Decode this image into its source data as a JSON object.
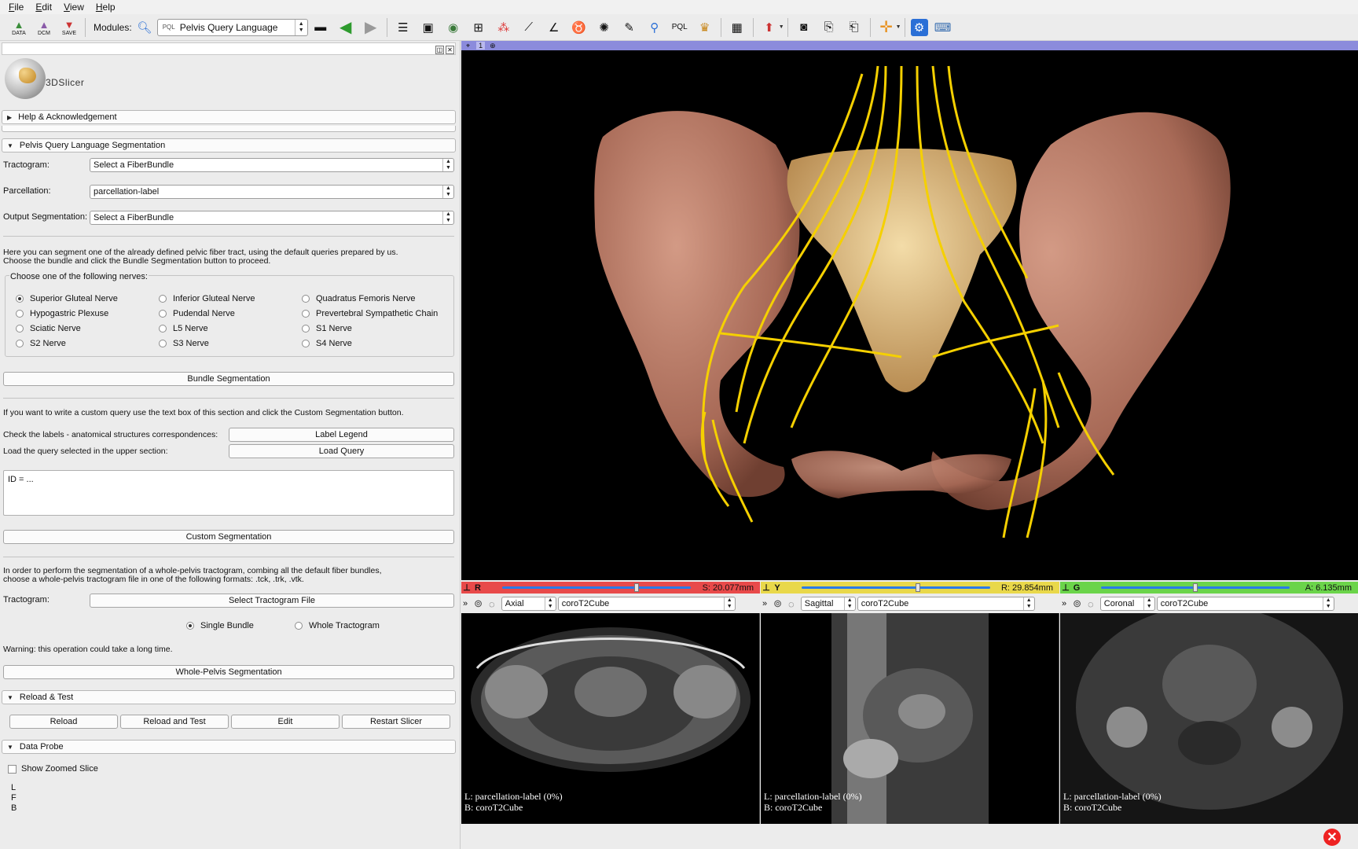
{
  "menu": [
    "File",
    "Edit",
    "View",
    "Help"
  ],
  "toolbar": {
    "data_label": "DATA",
    "dcm_label": "DCM",
    "save_label": "SAVE",
    "modules_label": "Modules:",
    "module_prefix": "PQL",
    "module_selected": "Pelvis Query Language",
    "pql_label": "PQL"
  },
  "app": {
    "logo_text": "3DSlicer"
  },
  "sections": {
    "help": "Help & Acknowledgement",
    "pql": "Pelvis Query Language Segmentation",
    "reload": "Reload & Test",
    "probe": "Data Probe"
  },
  "form": {
    "tractogram_label": "Tractogram:",
    "tractogram_value": "Select a FiberBundle",
    "parcellation_label": "Parcellation:",
    "parcellation_value": "parcellation-label",
    "output_label": "Output Segmentation:",
    "output_value": "Select a FiberBundle"
  },
  "intro_line1": "Here you can segment one of the already defined pelvic fiber tract, using the default queries prepared by us.",
  "intro_line2": "Choose the bundle and click the Bundle Segmentation button to proceed.",
  "nerves_title": "Choose one of the following nerves:",
  "nerves": [
    "Superior Gluteal Nerve",
    "Inferior Gluteal Nerve",
    "Quadratus Femoris Nerve",
    "Hypogastric Plexuse",
    "Pudendal Nerve",
    "Prevertebral Sympathetic Chain",
    "Sciatic Nerve",
    "L5 Nerve",
    "S1 Nerve",
    "S2 Nerve",
    "S3 Nerve",
    "S4 Nerve"
  ],
  "bundle_button": "Bundle Segmentation",
  "custom_intro": "If you want to write a custom query use the text box of this section and click the Custom Segmentation button.",
  "check_labels_text": "Check the labels - anatomical structures correspondences:",
  "label_legend_button": "Label Legend",
  "load_query_text": "Load the query selected in the upper section:",
  "load_query_button": "Load Query",
  "query_text": "ID = ...",
  "custom_button": "Custom Segmentation",
  "whole_line1": "In order to perform the segmentation of a whole-pelvis tractogram, combing all the default fiber bundles,",
  "whole_line2": "choose a whole-pelvis tractogram file in one of the following formats: .tck, .trk, .vtk.",
  "whole_tractogram_label": "Tractogram:",
  "select_tractogram_button": "Select Tractogram File",
  "mode_single": "Single Bundle",
  "mode_whole": "Whole Tractogram",
  "warning": "Warning: this operation could take a long time.",
  "whole_button": "Whole-Pelvis Segmentation",
  "reload_buttons": [
    "Reload",
    "Reload and Test",
    "Edit",
    "Restart Slicer"
  ],
  "show_zoomed": "Show Zoomed Slice",
  "probe_letters": [
    "L",
    "F",
    "B"
  ],
  "view3d": {
    "number": "1"
  },
  "slices": [
    {
      "letter": "R",
      "offset": "S: 20.077mm",
      "orientation": "Axial",
      "volume": "coroT2Cube",
      "color": "#e84a4a",
      "ann_l": "L: parcellation-label (0%)",
      "ann_b": "B: coroT2Cube",
      "slider": 0.72
    },
    {
      "letter": "Y",
      "offset": "R: 29.854mm",
      "orientation": "Sagittal",
      "volume": "coroT2Cube",
      "color": "#e9d84a",
      "ann_l": "L: parcellation-label (0%)",
      "ann_b": "B: coroT2Cube",
      "slider": 0.62
    },
    {
      "letter": "G",
      "offset": "A: 6.135mm",
      "orientation": "Coronal",
      "volume": "coroT2Cube",
      "color": "#6bd44a",
      "ann_l": "L: parcellation-label (0%)",
      "ann_b": "B: coroT2Cube",
      "slider": 0.5
    }
  ],
  "colors": {
    "bone": "#b97b68",
    "sacrum": "#e8c88e",
    "fiber": "#f5d000",
    "view_bar": "#8b8bdc"
  }
}
